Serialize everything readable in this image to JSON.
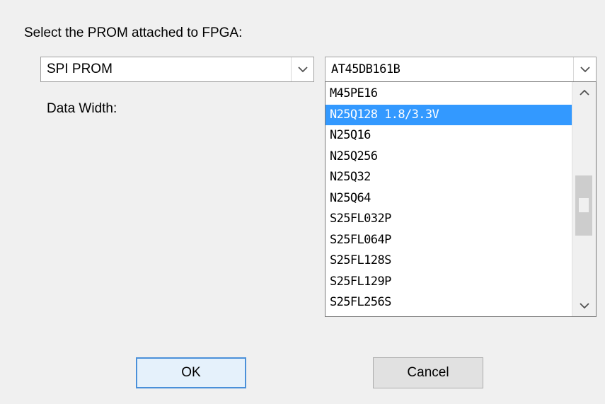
{
  "dialog": {
    "prompt": "Select the PROM attached to FPGA:",
    "prom_type": "SPI PROM",
    "prom_part": "AT45DB161B",
    "data_width_label": "Data Width:",
    "ok_label": "OK",
    "cancel_label": "Cancel"
  },
  "dropdown": {
    "items": [
      "M45PE16",
      "N25Q128 1.8/3.3V",
      "N25Q16",
      "N25Q256",
      "N25Q32",
      "N25Q64",
      "S25FL032P",
      "S25FL064P",
      "S25FL128S",
      "S25FL129P",
      "S25FL256S"
    ],
    "selected_index": 1
  },
  "colors": {
    "selection": "#3399ff",
    "dialog_background": "#f0f0f0",
    "default_button_border": "#4a90d9"
  }
}
